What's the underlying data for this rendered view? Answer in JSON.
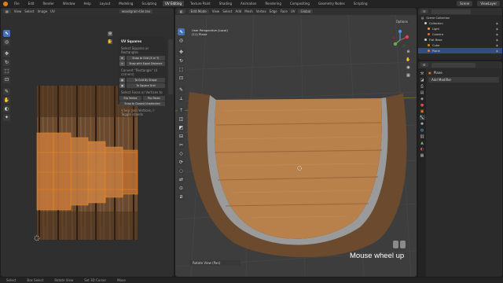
{
  "topbar": {
    "menus": [
      "File",
      "Edit",
      "Render",
      "Window",
      "Help"
    ],
    "workspaces": [
      "Layout",
      "Modeling",
      "Sculpting",
      "UV Editing",
      "Texture Paint",
      "Shading",
      "Animation",
      "Rendering",
      "Compositing",
      "Geometry Nodes",
      "Scripting"
    ],
    "active_workspace": "UV Editing",
    "scene": "Scene",
    "view_layer": "ViewLayer"
  },
  "uv_editor": {
    "header_items": [
      "View",
      "Select",
      "Image",
      "UV"
    ],
    "image_name": "woodgrain-tile.tex",
    "panel_title": "UV Squares",
    "section1": "Select Squares or Rectangles",
    "btn_snap_grid": "Snap to Grid (X or Y)",
    "btn_snap_equal": "Snap with Equal Distance",
    "section2": "Convert \"Rectangle\" (4 corners)",
    "btn_grid_shape": "To Grid By Shape",
    "btn_square_grid": "To Square Grid",
    "section3": "Select Faces or Vertices to",
    "btn_rip_vertex": "Rip Vertex",
    "btn_rip_faces": "Rip Faces",
    "btn_snap_closest": "Snap to Closest Unselected",
    "section4": "V key: Join Vertices, I: Toggle islands"
  },
  "viewport": {
    "header_items": [
      "View",
      "Select",
      "Add",
      "Mesh",
      "Vertex",
      "Edge",
      "Face",
      "UV"
    ],
    "mode": "Edit Mode",
    "transform": "Global",
    "options": "Options",
    "info_line1": "User Perspective (Local)",
    "info_line2": "(11) Plane",
    "bottom_strip": "Rotate View (Pan)",
    "caption": "Mouse wheel up"
  },
  "outliner": {
    "title": "Scene Collection",
    "rows": [
      "Scene Collection",
      "Collection",
      "Light",
      "Camera",
      "Flat Base",
      "Cube",
      "Plane"
    ]
  },
  "properties": {
    "object": "Plane",
    "add_modifier": "Add Modifier"
  },
  "statusbar": {
    "items": [
      "Select",
      "Box Select",
      "Rotate View",
      "Set 3D Cursor",
      "Move"
    ]
  },
  "colors": {
    "accent_blue": "#4772b3",
    "orange_uv": "#e8821c",
    "wood_light": "#b07a45",
    "wood_dark": "#5a3e28"
  }
}
